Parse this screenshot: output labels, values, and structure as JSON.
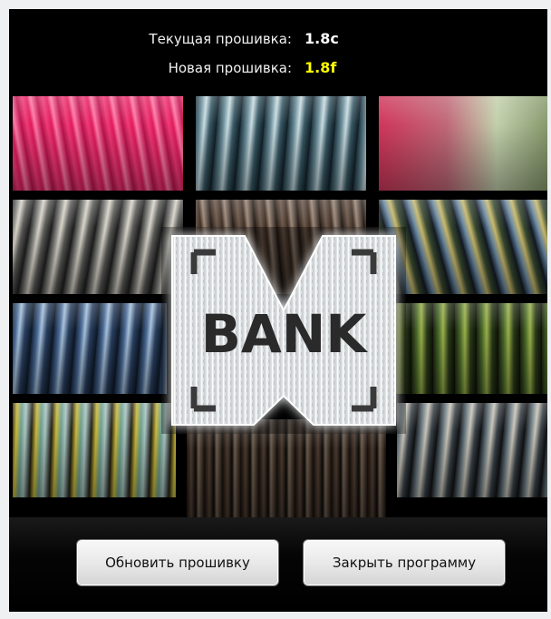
{
  "firmware": {
    "current_label": "Текущая прошивка:",
    "current_value": "1.8c",
    "new_label": "Новая прошивка:",
    "new_value": "1.8f"
  },
  "logo": {
    "text": "BANK",
    "mark": "M"
  },
  "buttons": {
    "update_label": "Обновить прошивку",
    "close_label": "Закрыть программу"
  },
  "colors": {
    "background": "#000000",
    "current_value": "#ffffff",
    "new_value": "#ffff00"
  }
}
